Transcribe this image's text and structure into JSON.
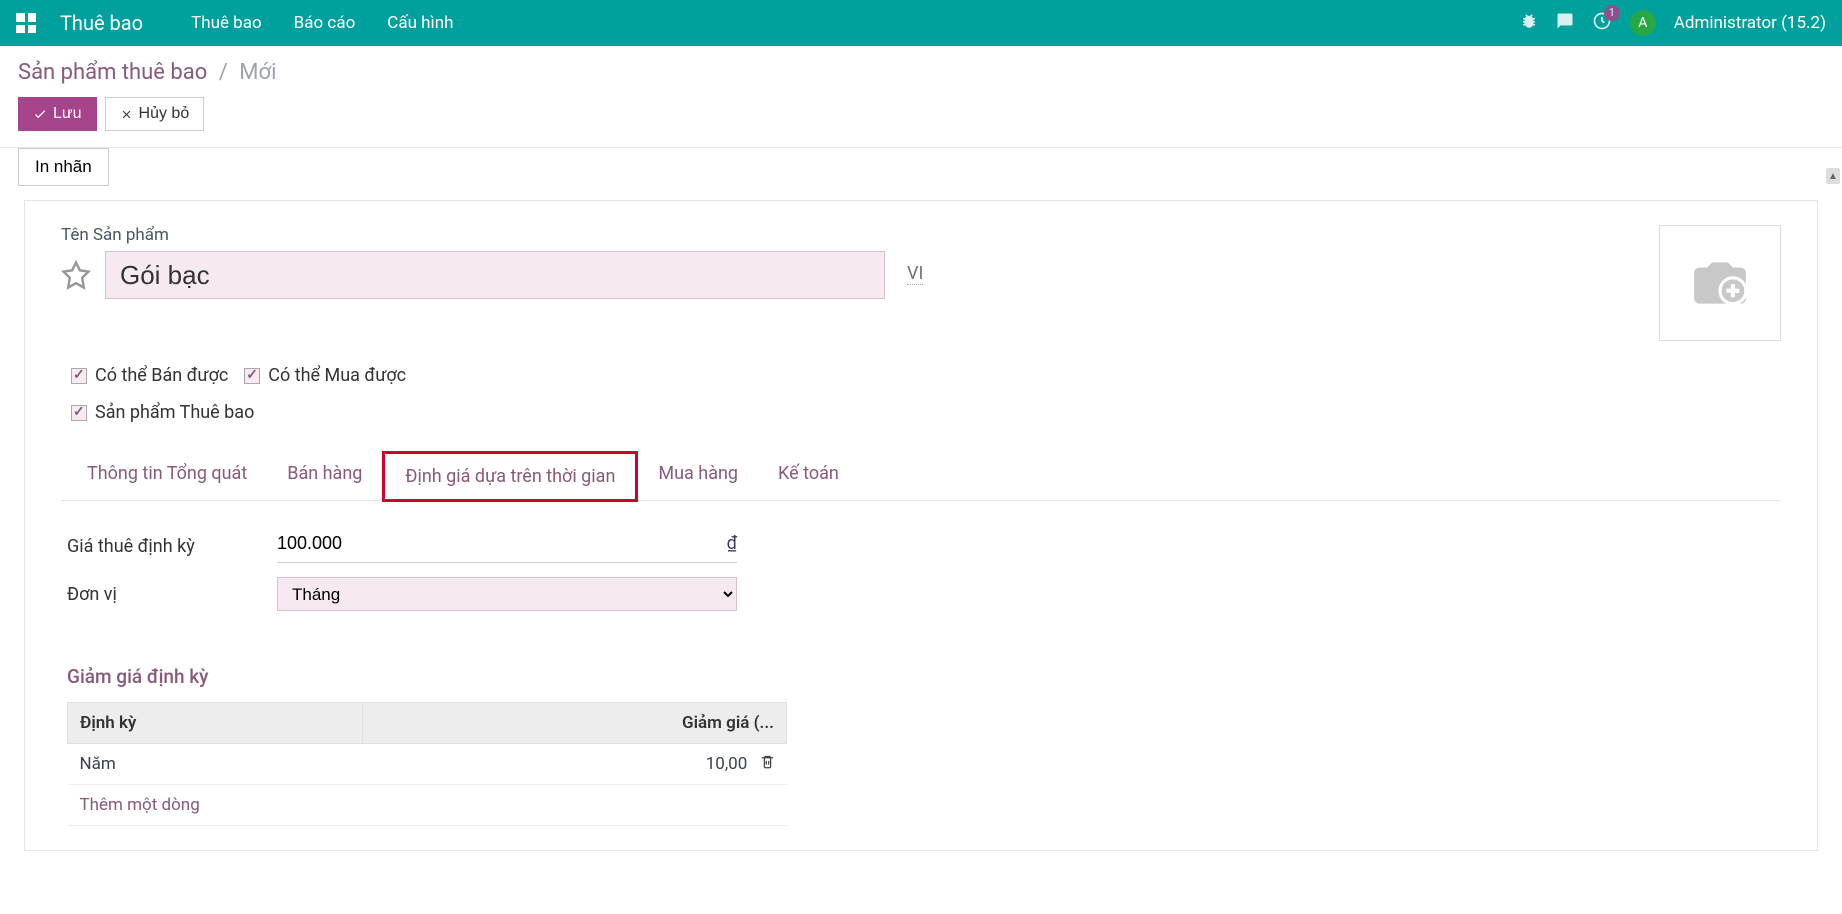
{
  "navbar": {
    "brand": "Thuê bao",
    "menu": [
      {
        "label": "Thuê bao"
      },
      {
        "label": "Báo cáo"
      },
      {
        "label": "Cấu hình"
      }
    ],
    "notif_badge": "1",
    "avatar_letter": "A",
    "user": "Administrator (15.2)"
  },
  "breadcrumb": {
    "root": "Sản phẩm thuê bao",
    "current": "Mới"
  },
  "buttons": {
    "save": "Lưu",
    "discard": "Hủy bỏ",
    "print_label": "In nhãn"
  },
  "product": {
    "name_label": "Tên Sản phẩm",
    "name": "Gói bạc",
    "lang_badge": "VI",
    "checks": {
      "can_sell": "Có thể Bán được",
      "can_purchase": "Có thể Mua được",
      "is_subscription": "Sản phẩm Thuê bao"
    }
  },
  "tabs": [
    {
      "label": "Thông tin Tổng quát"
    },
    {
      "label": "Bán hàng"
    },
    {
      "label": "Định giá dựa trên thời gian"
    },
    {
      "label": "Mua hàng"
    },
    {
      "label": "Kế toán"
    }
  ],
  "time_pricing": {
    "price_label": "Giá thuê định kỳ",
    "price_value": "100.000",
    "currency": "₫",
    "unit_label": "Đơn vị",
    "unit_value": "Tháng"
  },
  "discount_section": {
    "title": "Giảm giá định kỳ",
    "columns": {
      "period": "Định kỳ",
      "discount": "Giảm giá (..."
    },
    "rows": [
      {
        "period": "Năm",
        "discount": "10,00"
      }
    ],
    "add_line": "Thêm một dòng"
  }
}
